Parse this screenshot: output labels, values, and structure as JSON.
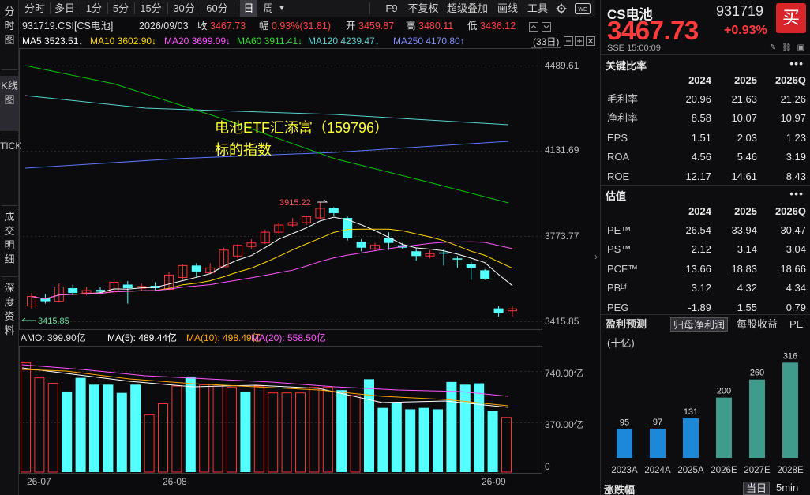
{
  "left_tabs": [
    "分时图",
    "K线图",
    "TICK",
    "成交明细",
    "深度资料"
  ],
  "toolbar": {
    "left_items": [
      "分时",
      "多日",
      "1分",
      "5分",
      "15分",
      "30分",
      "60分",
      "日",
      "周"
    ],
    "selected": "日",
    "right_items": [
      "F9",
      "不复权",
      "超级叠加",
      "画线",
      "工具"
    ]
  },
  "info": {
    "code_name": "931719.CSI[CS电池]",
    "date": "2026/09/03",
    "close_label": "收",
    "close": "3467.73",
    "range_label": "幅",
    "range": "0.93%(31.81)",
    "open_label": "开",
    "open": "3459.87",
    "high_label": "高",
    "high": "3480.11",
    "low_label": "低",
    "low": "3436.12"
  },
  "ma_line": {
    "ma5": "MA5  3523.51↓",
    "ma10": "MA10  3602.90↓",
    "ma20": "MA20  3699.09↓",
    "ma60": "MA60  3911.41↓",
    "ma120": "MA120  4239.47↓",
    "ma250": "MA250  4170.80↑",
    "days": "(33日)"
  },
  "annotation_line1": "电池ETF汇添富（159796）",
  "annotation_line2": "标的指数",
  "high_marker": "3915.22",
  "low_marker": "3415.85",
  "price_axis": [
    "4489.61",
    "4131.69",
    "3773.77",
    "3415.85"
  ],
  "amo_line": {
    "amo": "AMO: 399.90亿",
    "ma5": "MA(5): 489.44亿",
    "ma10": "MA(10): 498.49亿",
    "ma20": "MA(20): 558.50亿"
  },
  "volume_axis": [
    "740.00亿",
    "370.00亿",
    "0"
  ],
  "dates": [
    "26-07",
    "26-08",
    "26-09"
  ],
  "colors": {
    "up": "#ff3232",
    "down": "#54ffff",
    "ma5": "#ffffff",
    "ma10": "#ffd700",
    "ma20": "#ff55ff",
    "ma60": "#00c800",
    "ma120": "#5ad2d2",
    "ma250": "#5a78ff",
    "annotation": "#ffff33"
  },
  "candles": [
    {
      "o": 3480,
      "c": 3520,
      "h": 3535,
      "l": 3470
    },
    {
      "o": 3515,
      "c": 3500,
      "h": 3530,
      "l": 3490
    },
    {
      "o": 3500,
      "c": 3560,
      "h": 3575,
      "l": 3495
    },
    {
      "o": 3555,
      "c": 3535,
      "h": 3570,
      "l": 3525
    },
    {
      "o": 3535,
      "c": 3545,
      "h": 3560,
      "l": 3525
    },
    {
      "o": 3548,
      "c": 3540,
      "h": 3560,
      "l": 3530
    },
    {
      "o": 3540,
      "c": 3580,
      "h": 3590,
      "l": 3532
    },
    {
      "o": 3570,
      "c": 3555,
      "h": 3585,
      "l": 3490
    },
    {
      "o": 3555,
      "c": 3562,
      "h": 3575,
      "l": 3545
    },
    {
      "o": 3565,
      "c": 3555,
      "h": 3580,
      "l": 3545
    },
    {
      "o": 3550,
      "c": 3610,
      "h": 3625,
      "l": 3548
    },
    {
      "o": 3600,
      "c": 3650,
      "h": 3655,
      "l": 3590
    },
    {
      "o": 3650,
      "c": 3625,
      "h": 3660,
      "l": 3600
    },
    {
      "o": 3620,
      "c": 3640,
      "h": 3660,
      "l": 3615
    },
    {
      "o": 3645,
      "c": 3715,
      "h": 3725,
      "l": 3640
    },
    {
      "o": 3690,
      "c": 3735,
      "h": 3740,
      "l": 3680
    },
    {
      "o": 3730,
      "c": 3745,
      "h": 3760,
      "l": 3720
    },
    {
      "o": 3745,
      "c": 3790,
      "h": 3800,
      "l": 3740
    },
    {
      "o": 3790,
      "c": 3820,
      "h": 3830,
      "l": 3780
    },
    {
      "o": 3820,
      "c": 3830,
      "h": 3850,
      "l": 3810
    },
    {
      "o": 3830,
      "c": 3855,
      "h": 3860,
      "l": 3820
    },
    {
      "o": 3850,
      "c": 3890,
      "h": 3915,
      "l": 3845
    },
    {
      "o": 3890,
      "c": 3870,
      "h": 3895,
      "l": 3860
    },
    {
      "o": 3850,
      "c": 3765,
      "h": 3855,
      "l": 3755
    },
    {
      "o": 3750,
      "c": 3725,
      "h": 3760,
      "l": 3710
    },
    {
      "o": 3720,
      "c": 3735,
      "h": 3745,
      "l": 3710
    },
    {
      "o": 3765,
      "c": 3745,
      "h": 3790,
      "l": 3715
    },
    {
      "o": 3735,
      "c": 3725,
      "h": 3745,
      "l": 3720
    },
    {
      "o": 3710,
      "c": 3690,
      "h": 3725,
      "l": 3670
    },
    {
      "o": 3690,
      "c": 3700,
      "h": 3715,
      "l": 3680
    },
    {
      "o": 3705,
      "c": 3700,
      "h": 3720,
      "l": 3650
    },
    {
      "o": 3680,
      "c": 3675,
      "h": 3690,
      "l": 3640
    },
    {
      "o": 3655,
      "c": 3640,
      "h": 3665,
      "l": 3590
    },
    {
      "o": 3630,
      "c": 3595,
      "h": 3635,
      "l": 3590
    },
    {
      "o": 3470,
      "c": 3450,
      "h": 3480,
      "l": 3436
    },
    {
      "o": 3460,
      "c": 3468,
      "h": 3480,
      "l": 3436
    }
  ],
  "volumes": [
    {
      "v": 800,
      "up": true
    },
    {
      "v": 690,
      "up": true
    },
    {
      "v": 650,
      "up": true
    },
    {
      "v": 590,
      "up": false
    },
    {
      "v": 690,
      "up": false
    },
    {
      "v": 640,
      "up": false
    },
    {
      "v": 640,
      "up": false
    },
    {
      "v": 580,
      "up": false
    },
    {
      "v": 640,
      "up": false
    },
    {
      "v": 420,
      "up": true
    },
    {
      "v": 500,
      "up": true
    },
    {
      "v": 630,
      "up": true
    },
    {
      "v": 700,
      "up": false
    },
    {
      "v": 640,
      "up": true
    },
    {
      "v": 630,
      "up": true
    },
    {
      "v": 620,
      "up": true
    },
    {
      "v": 590,
      "up": false
    },
    {
      "v": 630,
      "up": true
    },
    {
      "v": 580,
      "up": true
    },
    {
      "v": 580,
      "up": true
    },
    {
      "v": 580,
      "up": true
    },
    {
      "v": 620,
      "up": true
    },
    {
      "v": 620,
      "up": true
    },
    {
      "v": 600,
      "up": false
    },
    {
      "v": 560,
      "up": true
    },
    {
      "v": 680,
      "up": false
    },
    {
      "v": 470,
      "up": false
    },
    {
      "v": 510,
      "up": false
    },
    {
      "v": 460,
      "up": false
    },
    {
      "v": 470,
      "up": false
    },
    {
      "v": 460,
      "up": false
    },
    {
      "v": 660,
      "up": false
    },
    {
      "v": 640,
      "up": false
    },
    {
      "v": 650,
      "up": false
    },
    {
      "v": 450,
      "up": false
    },
    {
      "v": 400,
      "up": true
    }
  ],
  "right_panel": {
    "name": "CS电池",
    "code": "931719",
    "buy": "买",
    "price": "3467.73",
    "change": "+0.93%",
    "exchange_time": "SSE  15:00:09",
    "key_ratio_title": "关键比率",
    "years": [
      "2024",
      "2025",
      "2026Q"
    ],
    "key_ratios": [
      {
        "label": "毛利率",
        "v": [
          "20.96",
          "21.63",
          "21.26"
        ]
      },
      {
        "label": "净利率",
        "v": [
          "8.58",
          "10.07",
          "10.97"
        ]
      },
      {
        "label": "EPS",
        "v": [
          "1.51",
          "2.03",
          "1.23"
        ]
      },
      {
        "label": "ROA",
        "v": [
          "4.56",
          "5.46",
          "3.19"
        ]
      },
      {
        "label": "ROE",
        "v": [
          "12.17",
          "14.61",
          "8.43"
        ]
      }
    ],
    "valuation_title": "估值",
    "valuation": [
      {
        "label": "PE™",
        "v": [
          "26.54",
          "33.94",
          "30.47"
        ]
      },
      {
        "label": "PS™",
        "v": [
          "2.12",
          "3.14",
          "3.04"
        ]
      },
      {
        "label": "PCF™",
        "v": [
          "13.66",
          "18.83",
          "18.66"
        ]
      },
      {
        "label": "PBᴸᶠ",
        "v": [
          "3.12",
          "4.32",
          "4.34"
        ]
      },
      {
        "label": "PEG",
        "v": [
          "-1.89",
          "1.55",
          "0.79"
        ]
      }
    ],
    "forecast_tabs": [
      "盈利预测",
      "归母净利润",
      "每股收益",
      "PE"
    ],
    "forecast_unit": "(十亿)",
    "forecast_bars": [
      {
        "label": "2023A",
        "value": 95,
        "kind": "actual"
      },
      {
        "label": "2024A",
        "value": 97,
        "kind": "actual"
      },
      {
        "label": "2025A",
        "value": 131,
        "kind": "actual"
      },
      {
        "label": "2026E",
        "value": 200,
        "kind": "estimate"
      },
      {
        "label": "2027E",
        "value": 260,
        "kind": "estimate"
      },
      {
        "label": "2028E",
        "value": 316,
        "kind": "estimate"
      }
    ],
    "bottom_label": "涨跌幅",
    "bottom_tabs": [
      "当日",
      "5min"
    ]
  }
}
